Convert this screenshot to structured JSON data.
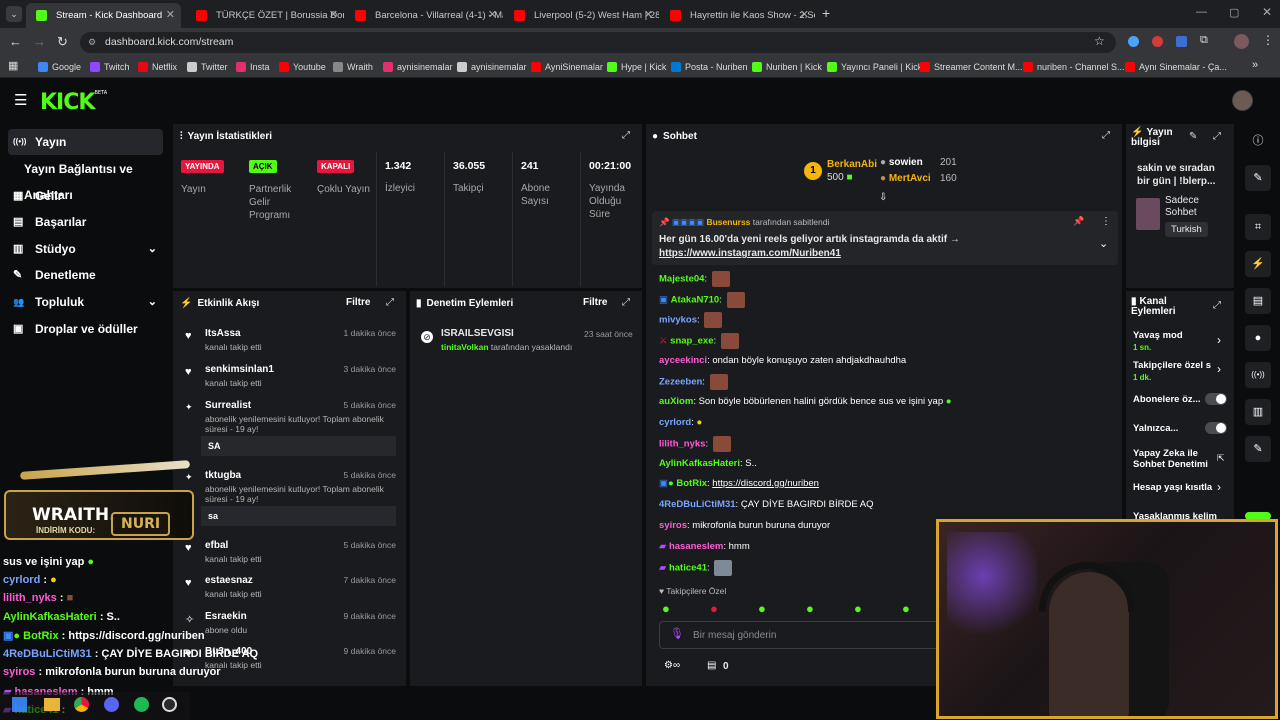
{
  "browser": {
    "tabs": [
      {
        "title": "Stream - Kick Dashboard",
        "fav": "#53fc18"
      },
      {
        "title": "TÜRKÇE ÖZET | Borussia Dortm",
        "fav": "#ff0000"
      },
      {
        "title": "Barcelona - Villarreal (4-1) - Ma",
        "fav": "#ff0000"
      },
      {
        "title": "Liverpool (5-2) West Ham | 28.",
        "fav": "#ff0000"
      },
      {
        "title": "Hayrettin ile Kaos Show - 2.Sez",
        "fav": "#ff0000"
      }
    ],
    "url": "dashboard.kick.com/stream",
    "bookmarks": [
      {
        "label": "Google",
        "color": "#4285f4"
      },
      {
        "label": "Twitch",
        "color": "#9146ff"
      },
      {
        "label": "Netflix",
        "color": "#e50914"
      },
      {
        "label": "Twitter",
        "color": "#cccccc"
      },
      {
        "label": "Insta",
        "color": "#e1306c"
      },
      {
        "label": "Youtube",
        "color": "#ff0000"
      },
      {
        "label": "Wraith",
        "color": "#888888"
      },
      {
        "label": "aynisinemalar",
        "color": "#e1306c"
      },
      {
        "label": "aynisinemalar",
        "color": "#cccccc"
      },
      {
        "label": "AyniSinemalar",
        "color": "#ff0000"
      },
      {
        "label": "Hype | Kick",
        "color": "#53fc18"
      },
      {
        "label": "Posta - Nuriben",
        "color": "#0078d4"
      },
      {
        "label": "Nuriben | Kick",
        "color": "#53fc18"
      },
      {
        "label": "Yayıncı Paneli | Kick",
        "color": "#53fc18"
      },
      {
        "label": "Streamer Content M...",
        "color": "#ff0000"
      },
      {
        "label": "nuriben - Channel S...",
        "color": "#ff0000"
      },
      {
        "label": "Aynı Sinemalar - Ça...",
        "color": "#ff0000"
      }
    ]
  },
  "logo": "KICK",
  "logo_sup": "BETA",
  "sidebar": {
    "items": [
      {
        "label": "Yayın",
        "icon": "((•))"
      },
      {
        "label": "Yayın Bağlantısı ve Anahtarı",
        "icon": ""
      },
      {
        "label": "Gelir",
        "icon": "▦"
      },
      {
        "label": "Başarılar",
        "icon": "▤"
      },
      {
        "label": "Stüdyo",
        "icon": "▥"
      },
      {
        "label": "Denetleme",
        "icon": "✎"
      },
      {
        "label": "Topluluk",
        "icon": "👥"
      },
      {
        "label": "Droplar ve ödüller",
        "icon": "▣"
      }
    ]
  },
  "stats": {
    "title": "Yayın İstatistikleri",
    "items": [
      {
        "badge": "YAYINDA",
        "label": "Yayın"
      },
      {
        "badge": "AÇIK",
        "label": "Partnerlik Gelir Programı"
      },
      {
        "badge": "KAPALI",
        "label": "Çoklu Yayın"
      },
      {
        "value": "1.342",
        "label": "İzleyici"
      },
      {
        "value": "36.055",
        "label": "Takipçi"
      },
      {
        "value": "241",
        "label": "Abone Sayısı"
      },
      {
        "value": "00:21:00",
        "label": "Yayında Olduğu Süre"
      }
    ]
  },
  "activity": {
    "title": "Etkinlik Akışı",
    "filter": "Filtre",
    "events": [
      {
        "name": "ItsAssa",
        "time": "1 dakika önce",
        "text": "kanalı takip etti"
      },
      {
        "name": "senkimsinlan1",
        "time": "3 dakika önce",
        "text": "kanalı takip etti"
      },
      {
        "name": "Surrealist",
        "time": "5 dakika önce",
        "text": "abonelik yenilemesini kutluyor! Toplam abonelik süresi - 19 ay!",
        "msg": "SA"
      },
      {
        "name": "tktugba",
        "time": "5 dakika önce",
        "text": "abonelik yenilemesini kutluyor! Toplam abonelik süresi - 19 ay!",
        "msg": "sa"
      },
      {
        "name": "efbal",
        "time": "5 dakika önce",
        "text": "kanalı takip etti"
      },
      {
        "name": "estaesnaz",
        "time": "7 dakika önce",
        "text": "kanalı takip etti"
      },
      {
        "name": "Esraekin",
        "time": "9 dakika önce",
        "text": "abone oldu"
      },
      {
        "name": "Bu3n_400",
        "time": "9 dakika önce",
        "text": "kanalı takip etti"
      }
    ]
  },
  "moderation": {
    "title": "Denetim Eylemleri",
    "filter": "Filtre",
    "entry": {
      "name": "ISRAILSEVGISI",
      "time": "23 saat önce",
      "mod": "tinitaVolkan",
      "text": "tarafından yasaklandı"
    }
  },
  "chat": {
    "title": "Sohbet",
    "top": [
      {
        "rank": "1",
        "name": "BerkanAbi",
        "value": "500"
      },
      {
        "name": "sowien",
        "value": "201"
      },
      {
        "name": "MertAvci",
        "value": "160"
      }
    ],
    "pinned": {
      "by": "Busenurss",
      "by_suffix": "tarafından sabitlendi",
      "text": "Her gün 16.00'da yeni reels geliyor artık instagramda da aktif →",
      "link": "https://www.instagram.com/Nuriben41"
    },
    "messages": [
      {
        "user": "Majeste04",
        "color": "#53fc18",
        "text": ""
      },
      {
        "user": "AtakaN710",
        "color": "#53fc18",
        "text": ""
      },
      {
        "user": "mivykos",
        "color": "#7aa5ff",
        "text": ""
      },
      {
        "user": "snap_exe",
        "color": "#53fc18",
        "text": ""
      },
      {
        "user": "ayceekinci",
        "color": "#ff5bd6",
        "text": "ondan böyle konuşuyo zaten ahdjakdhauhdha"
      },
      {
        "user": "Zezeeben",
        "color": "#7aa5ff",
        "text": ""
      },
      {
        "user": "auXiom",
        "color": "#53fc18",
        "text": "Son böyle böbürlenen halini gördük bence sus ve işini yap"
      },
      {
        "user": "cyrlord",
        "color": "#7aa5ff",
        "text": ""
      },
      {
        "user": "lilith_nyks",
        "color": "#ff5bd6",
        "text": ""
      },
      {
        "user": "AylinKafkasHateri",
        "color": "#53fc18",
        "text": "S.."
      },
      {
        "user": "BotRix",
        "color": "#53fc18",
        "text": "https://discord.gg/nuriben"
      },
      {
        "user": "4ReDBuLiCtiM31",
        "color": "#7aa5ff",
        "text": "ÇAY DİYE BAGIRDI BİRDE AQ"
      },
      {
        "user": "syiros",
        "color": "#ff5bd6",
        "text": "mikrofonla burun buruna duruyor"
      },
      {
        "user": "hasaneslem",
        "color": "#ff5bd6",
        "text": "hmm"
      },
      {
        "user": "hatice41",
        "color": "#53fc18",
        "text": ""
      }
    ],
    "followers_only": "Takipçilere Özel",
    "input_placeholder": "Bir mesaj gönderin",
    "bottom_count": "0"
  },
  "stream_info": {
    "title": "Yayın bilgisi",
    "text": "sakin ve sıradan bir gün | !blerp...",
    "mode": "Sadece Sohbet",
    "lang": "Turkish"
  },
  "channel_actions": {
    "title": "Kanal Eylemleri",
    "items": [
      {
        "label": "Yavaş mod",
        "sub": "1 sn."
      },
      {
        "label": "Takipçilere özel s",
        "sub": "1 dk."
      },
      {
        "label": "Abonelere öz...",
        "sub": ""
      },
      {
        "label": "Yalnızca...",
        "sub": ""
      },
      {
        "label": "Yapay Zeka ile Sohbet Denetimi",
        "sub": ""
      },
      {
        "label": "Hesap yaşı kısıtla",
        "sub": ""
      },
      {
        "label": "Yasaklanmış kelim",
        "sub": ""
      }
    ]
  },
  "overlay": {
    "brand": "WRAITH.",
    "code_label": "İNDİRİM KODU:",
    "code": "NURI",
    "chat": [
      {
        "user": "",
        "text": "sus ve işini yap"
      },
      {
        "user": "cyrlord",
        "text": ":"
      },
      {
        "user": "lilith_nyks",
        "text": ":"
      },
      {
        "user": "AylinKafkasHateri",
        "text": ": S.."
      },
      {
        "user": "BotRix",
        "text": ": https://discord.gg/nuriben"
      },
      {
        "user": "4ReDBuLiCtiM31",
        "text": ": ÇAY DİYE BAGIRDI BİRDE AQ"
      },
      {
        "user": "syiros",
        "text": ": mikrofonla burun buruna duruyor"
      },
      {
        "user": "hasaneslem",
        "text": ": hmm"
      },
      {
        "user": "hatice41",
        "text": ":"
      }
    ]
  }
}
